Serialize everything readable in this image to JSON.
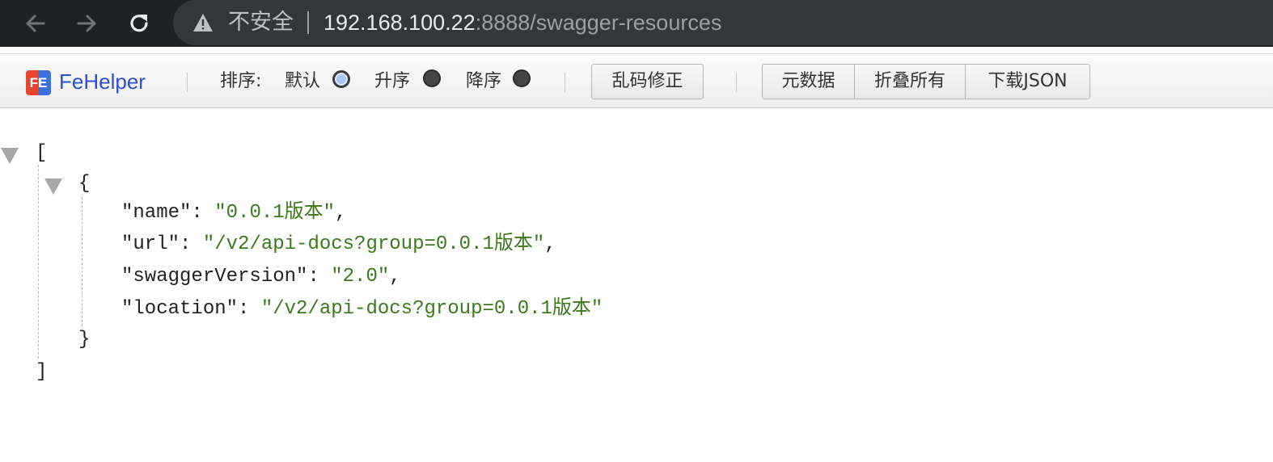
{
  "browser": {
    "security_text": "不安全",
    "url_host": "192.168.100.22",
    "url_path": ":8888/swagger-resources"
  },
  "fehelper": {
    "logo_text": "FE",
    "title": "FeHelper",
    "sort_label": "排序:",
    "sort_options": [
      {
        "label": "默认",
        "selected": true
      },
      {
        "label": "升序",
        "selected": false
      },
      {
        "label": "降序",
        "selected": false
      }
    ],
    "fix_encoding_button": "乱码修正",
    "metadata_button": "元数据",
    "collapse_all_button": "折叠所有",
    "download_json_button": "下载JSON"
  },
  "json_view": {
    "open_array": "[",
    "open_object": "{",
    "close_object": "}",
    "close_array": "]",
    "entries": [
      {
        "key": "\"name\"",
        "value": "\"0.0.1版本\"",
        "comma": ","
      },
      {
        "key": "\"url\"",
        "value": "\"/v2/api-docs?group=0.0.1版本\"",
        "comma": ","
      },
      {
        "key": "\"swaggerVersion\"",
        "value": "\"2.0\"",
        "comma": ","
      },
      {
        "key": "\"location\"",
        "value": "\"/v2/api-docs?group=0.0.1版本\"",
        "comma": ""
      }
    ]
  }
}
